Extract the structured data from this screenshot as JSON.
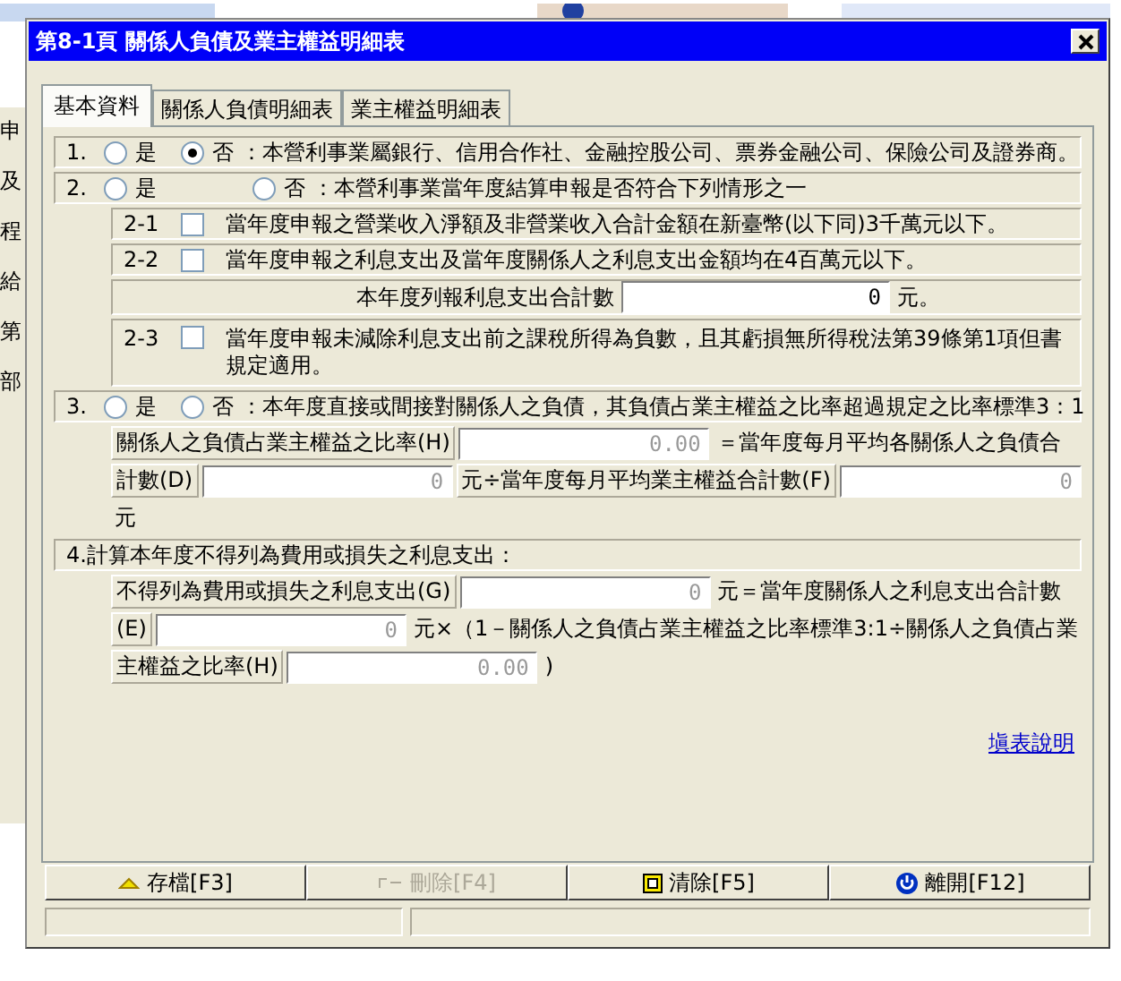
{
  "background": {
    "side_items": [
      "申",
      "及",
      "程",
      "給",
      "第",
      "部"
    ]
  },
  "window": {
    "title": "第8-1頁 關係人負債及業主權益明細表"
  },
  "tabs": [
    {
      "label": "基本資料",
      "selected": true
    },
    {
      "label": "關係人負債明細表",
      "selected": false
    },
    {
      "label": "業主權益明細表",
      "selected": false
    }
  ],
  "sections": [
    {
      "kind": "choice",
      "number": "1.",
      "options": [
        {
          "label": "是",
          "selected": false
        },
        {
          "label": "否",
          "selected": true
        }
      ],
      "text": "：本營利事業屬銀行、信用合作社、金融控股公司、票券金融公司、保險公司及證券商。"
    },
    {
      "kind": "choice",
      "number": "2.",
      "options": [
        {
          "label": "是",
          "selected": false
        },
        {
          "label": "否",
          "selected": false
        }
      ],
      "text": "：本營利事業當年度結算申報是否符合下列情形之一",
      "items": [
        {
          "kind": "check",
          "number": "2-1",
          "checked": false,
          "text": "當年度申報之營業收入淨額及非營業收入合計金額在新臺幣(以下同)3千萬元以下。"
        },
        {
          "kind": "check",
          "number": "2-2",
          "checked": false,
          "text": "當年度申報之利息支出及當年度關係人之利息支出金額均在4百萬元以下。"
        },
        {
          "kind": "amount",
          "label": "本年度列報利息支出合計數",
          "value": "0",
          "suffix": "元。"
        },
        {
          "kind": "check",
          "number": "2-3",
          "checked": false,
          "text": "當年度申報未減除利息支出前之課稅所得為負數，且其虧損無所得稅法第39條第1項但書規定適用。"
        }
      ]
    },
    {
      "kind": "choice",
      "number": "3.",
      "options": [
        {
          "label": "是",
          "selected": false
        },
        {
          "label": "否",
          "selected": false
        }
      ],
      "text": "：本年度直接或間接對關係人之負債，其負債占業主權益之比率超過規定之比率標準3：1",
      "lines": [
        [
          {
            "kind": "label",
            "text": "關係人之負債占業主權益之比率(H)"
          },
          {
            "kind": "field",
            "value": "0.00",
            "disabled": true
          },
          {
            "kind": "text",
            "text": "＝當年度每月平均各關係人之負債合"
          }
        ],
        [
          {
            "kind": "label",
            "text": "計數(D)"
          },
          {
            "kind": "field",
            "value": "0",
            "disabled": true
          },
          {
            "kind": "label",
            "text": "元÷當年度每月平均業主權益合計數(F)"
          },
          {
            "kind": "field",
            "value": "0",
            "disabled": true
          }
        ],
        [
          {
            "kind": "text",
            "text": "元"
          }
        ]
      ]
    },
    {
      "kind": "heading",
      "text": "4.計算本年度不得列為費用或損失之利息支出：",
      "lines": [
        [
          {
            "kind": "label",
            "text": "不得列為費用或損失之利息支出(G)"
          },
          {
            "kind": "field",
            "value": "0",
            "disabled": true
          },
          {
            "kind": "text",
            "text": "元＝當年度關係人之利息支出合計數"
          }
        ],
        [
          {
            "kind": "label",
            "text": "(E)"
          },
          {
            "kind": "field",
            "value": "0",
            "disabled": true
          },
          {
            "kind": "text",
            "text": "元×（1－關係人之負債占業主權益之比率標準3:1÷關係人之負債占業"
          }
        ],
        [
          {
            "kind": "label",
            "text": "主權益之比率(H)"
          },
          {
            "kind": "field",
            "value": "0.00",
            "disabled": true
          },
          {
            "kind": "text",
            "text": ")"
          }
        ]
      ]
    }
  ],
  "help_link": "塡表說明",
  "buttons": [
    {
      "label": "存檔[F3]",
      "kind": "save",
      "disabled": false
    },
    {
      "label": "刪除[F4]",
      "kind": "delete",
      "disabled": true
    },
    {
      "label": "清除[F5]",
      "kind": "clear",
      "disabled": false
    },
    {
      "label": "離開[F12]",
      "kind": "exit",
      "disabled": false
    }
  ]
}
